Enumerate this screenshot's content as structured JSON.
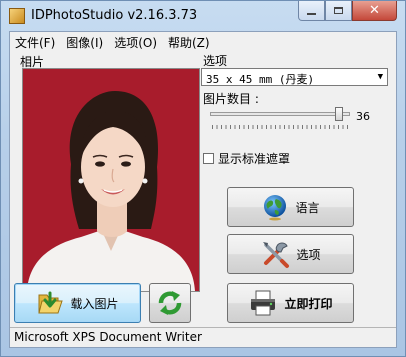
{
  "window": {
    "title": "IDPhotoStudio v2.16.3.73"
  },
  "menu": [
    {
      "label": "文件(F)"
    },
    {
      "label": "图像(I)"
    },
    {
      "label": "选项(O)"
    },
    {
      "label": "帮助(Z)"
    }
  ],
  "photo": {
    "label": "相片",
    "background_color": "#a81c2c"
  },
  "options": {
    "label": "选项",
    "size_value": "35 x 45 mm (丹麦)",
    "count_label": "图片数目 :",
    "count_value": "36",
    "slider_fraction": 0.95,
    "mask_label": "显示标准遮罩",
    "mask_checked": false
  },
  "buttons": {
    "language": "语言",
    "options": "选项",
    "load": "载入图片",
    "print": "立即打印"
  },
  "status": {
    "printer": "Microsoft XPS Document Writer"
  }
}
